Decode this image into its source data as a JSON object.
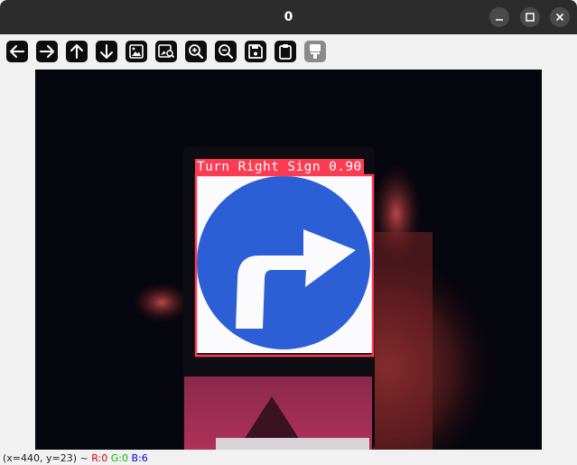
{
  "window": {
    "title": "0"
  },
  "window_controls": [
    "minimize-icon",
    "maximize-icon",
    "close-icon"
  ],
  "toolbar": {
    "buttons": [
      {
        "icon": "arrow-left-icon",
        "enabled": true
      },
      {
        "icon": "arrow-right-icon",
        "enabled": true
      },
      {
        "icon": "arrow-up-icon",
        "enabled": true
      },
      {
        "icon": "arrow-down-icon",
        "enabled": true
      },
      {
        "icon": "image-icon",
        "enabled": true
      },
      {
        "icon": "image-search-icon",
        "enabled": true
      },
      {
        "icon": "zoom-in-icon",
        "enabled": true
      },
      {
        "icon": "zoom-out-icon",
        "enabled": true
      },
      {
        "icon": "save-icon",
        "enabled": true
      },
      {
        "icon": "clipboard-icon",
        "enabled": true
      },
      {
        "icon": "properties-icon",
        "enabled": false
      }
    ]
  },
  "detection": {
    "label": "Turn Right Sign 0.90",
    "box_color": "#fb3c52"
  },
  "status": {
    "coords": "(x=440, y=23) ~ ",
    "r": "R:0",
    "g": "G:0",
    "b": "B:6"
  },
  "colors": {
    "titlebar": "#2c2c2c",
    "sign_blue": "#2c5fd6",
    "red_channel": "#e00000",
    "green_channel": "#00c000",
    "blue_channel": "#0000e0"
  }
}
